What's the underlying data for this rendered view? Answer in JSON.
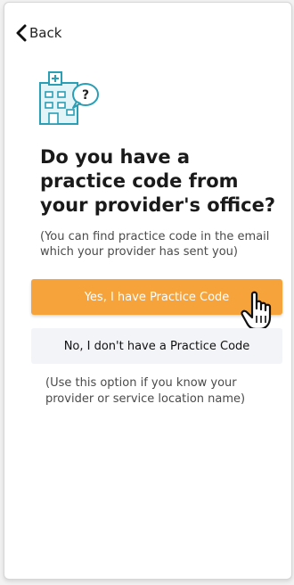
{
  "nav": {
    "back_label": "Back"
  },
  "icons": {
    "back": "chevron-left-icon",
    "illustration": "hospital-question-icon",
    "cursor": "hand-pointer-icon"
  },
  "question": {
    "title": "Do you have a practice code from your provider's office?",
    "subtitle": "(You can find practice code in the email which your provider has sent you)"
  },
  "options": {
    "yes_label": "Yes, I have Practice Code",
    "no_label": "No, I don't have a Practice Code",
    "no_note": "(Use this option if you know your provider or service location name)"
  },
  "colors": {
    "accent": "#f5a33a",
    "illustration_teal": "#2a9eb5",
    "secondary_button_bg": "#f3f4f8"
  }
}
